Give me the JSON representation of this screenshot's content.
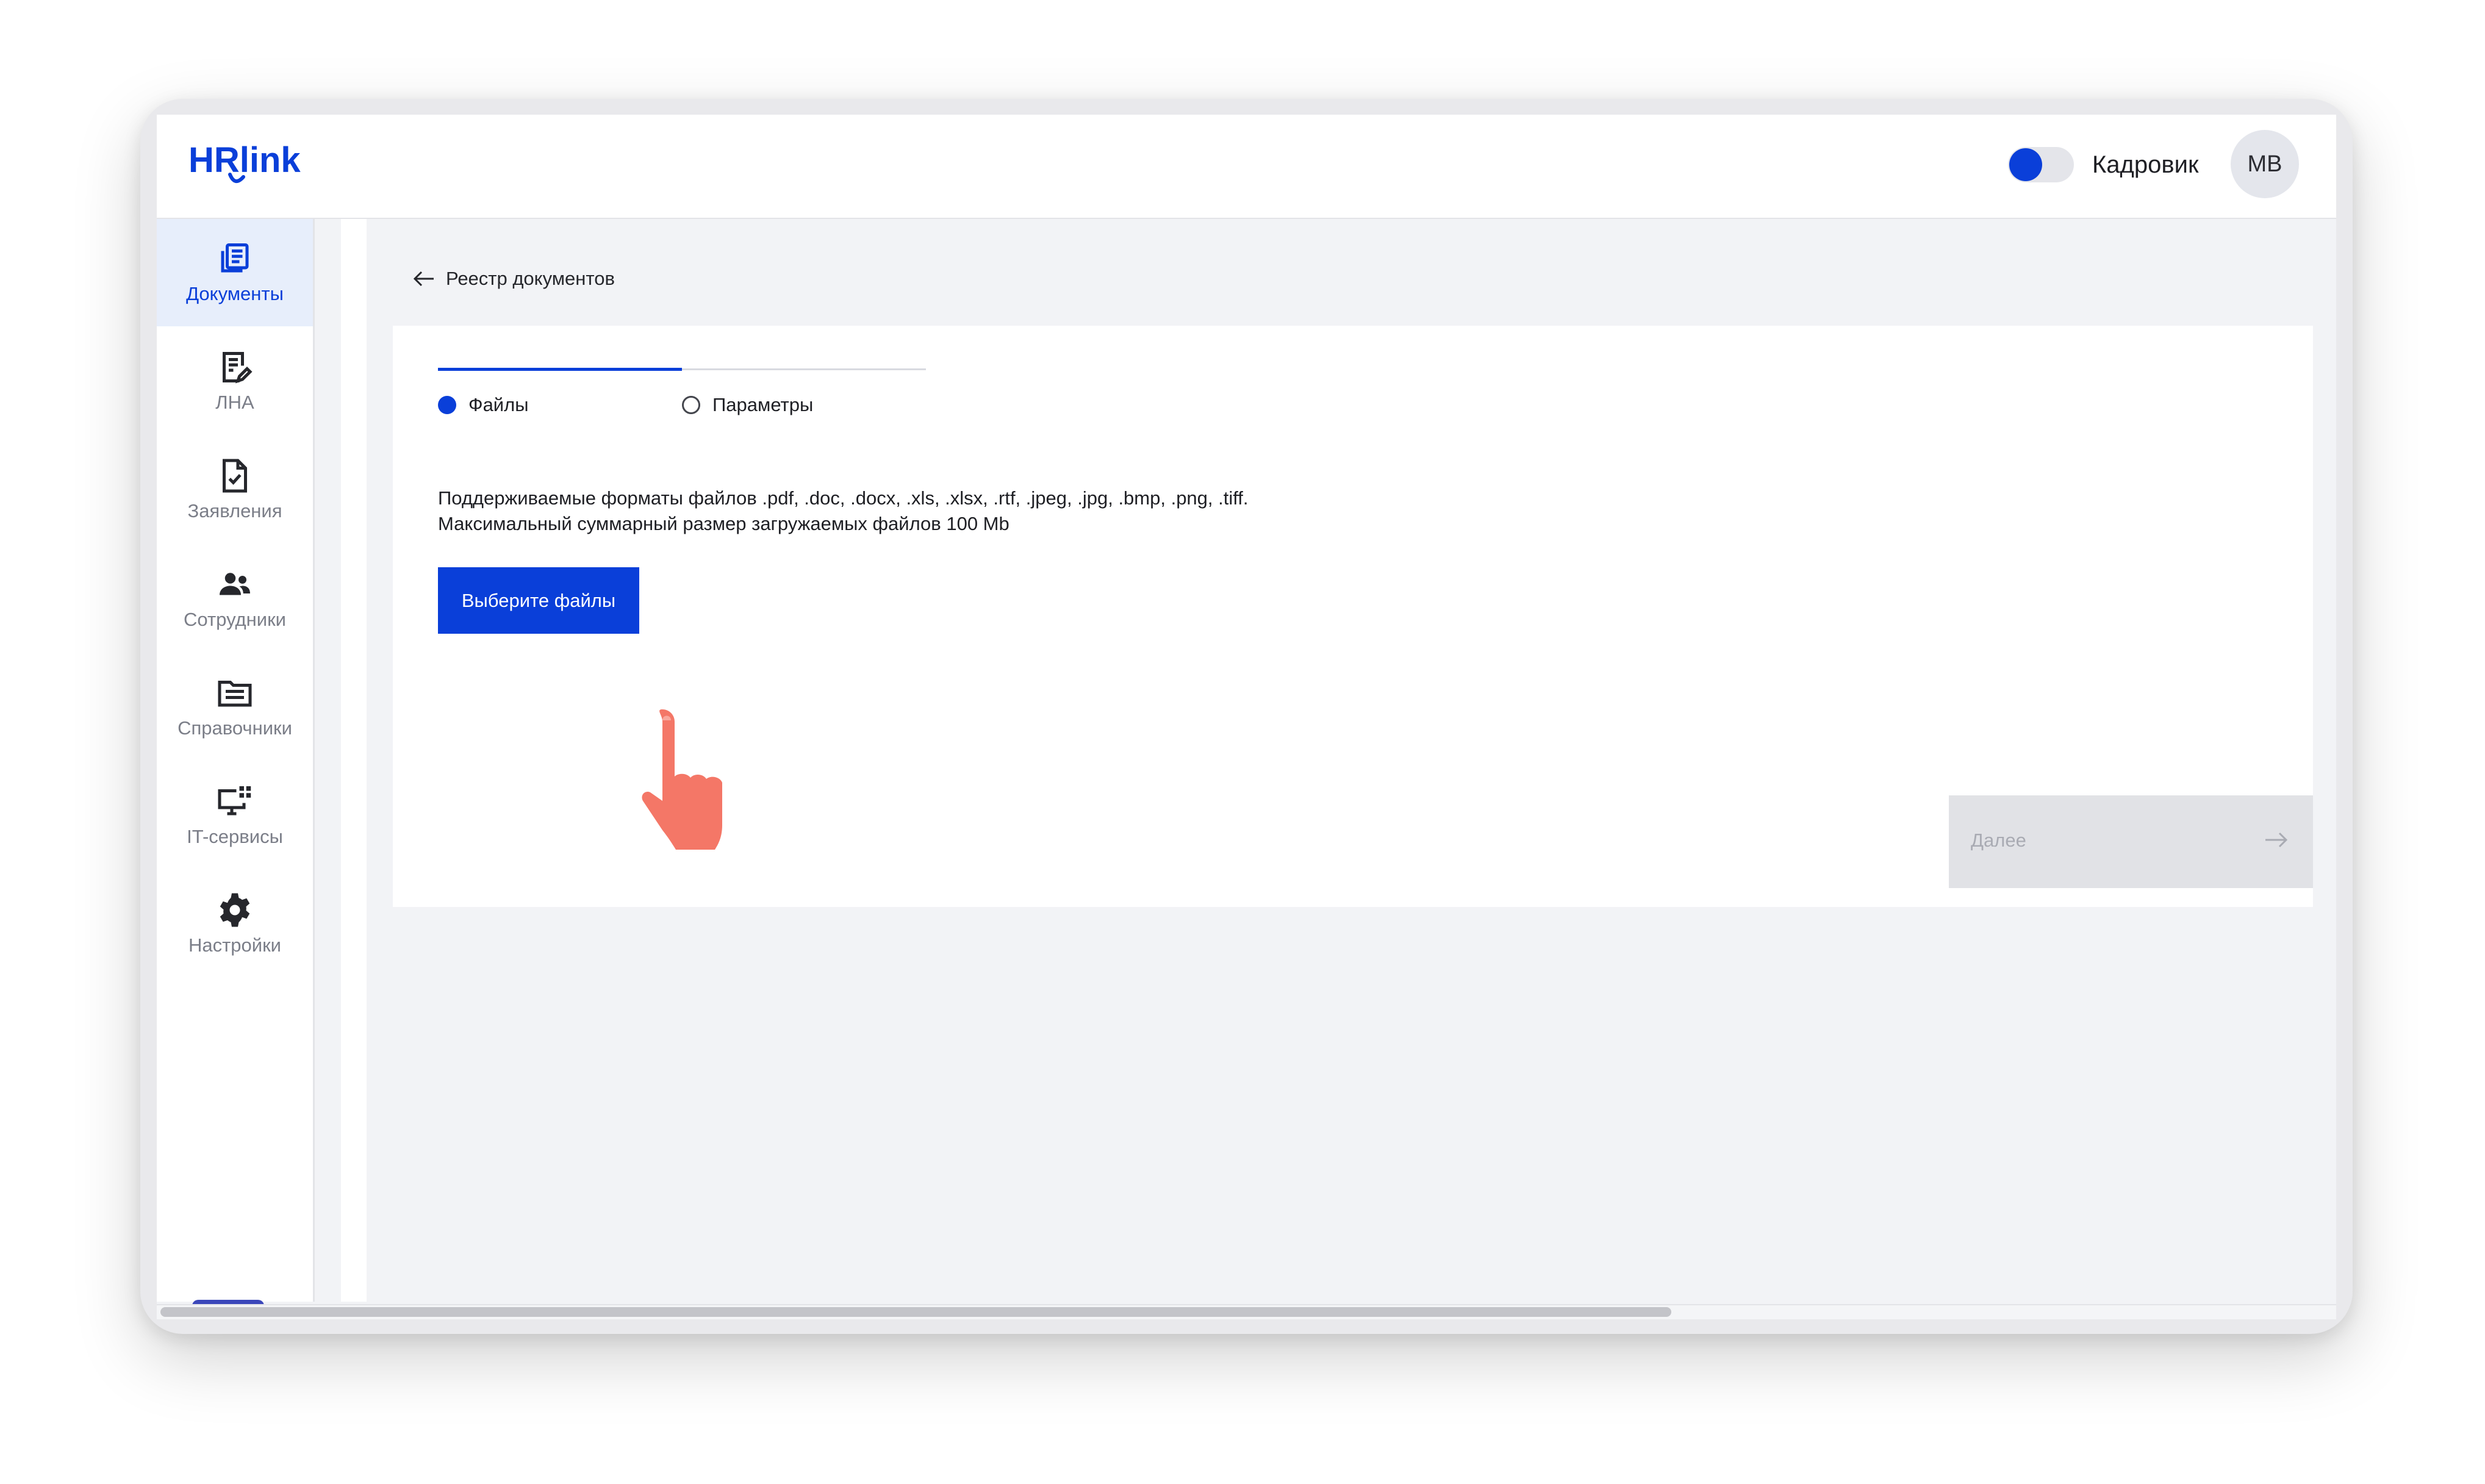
{
  "header": {
    "logo_text": "HRlink",
    "role_label": "Кадровик",
    "avatar_initials": "MB",
    "role_toggle_on": true
  },
  "sidebar": {
    "items": [
      {
        "label": "Документы",
        "icon": "documents-icon",
        "active": true
      },
      {
        "label": "ЛНА",
        "icon": "lna-document-edit-icon",
        "active": false
      },
      {
        "label": "Заявления",
        "icon": "application-check-icon",
        "active": false
      },
      {
        "label": "Сотрудники",
        "icon": "employees-icon",
        "active": false
      },
      {
        "label": "Справочники",
        "icon": "folder-icon",
        "active": false
      },
      {
        "label": "IT-сервисы",
        "icon": "monitor-apps-icon",
        "active": false
      },
      {
        "label": "Настройки",
        "icon": "gear-icon",
        "active": false
      }
    ],
    "help_label": "?"
  },
  "breadcrumb": {
    "back_label": "Реестр документов"
  },
  "stepper": {
    "steps": [
      {
        "label": "Файлы",
        "active": true
      },
      {
        "label": "Параметры",
        "active": false
      }
    ]
  },
  "upload": {
    "formats_text": "Поддерживаемые форматы файлов .pdf, .doc, .docx, .xls, .xlsx, .rtf, .jpeg, .jpg, .bmp, .png, .tiff.",
    "size_text": "Максимальный суммарный размер загружаемых файлов 100 Mb",
    "button_label": "Выберите файлы"
  },
  "footer": {
    "next_label": "Далее",
    "next_enabled": false
  },
  "colors": {
    "accent": "#0a3fd9",
    "help_button": "#3b47ba",
    "pointer_hand": "#f47767"
  }
}
